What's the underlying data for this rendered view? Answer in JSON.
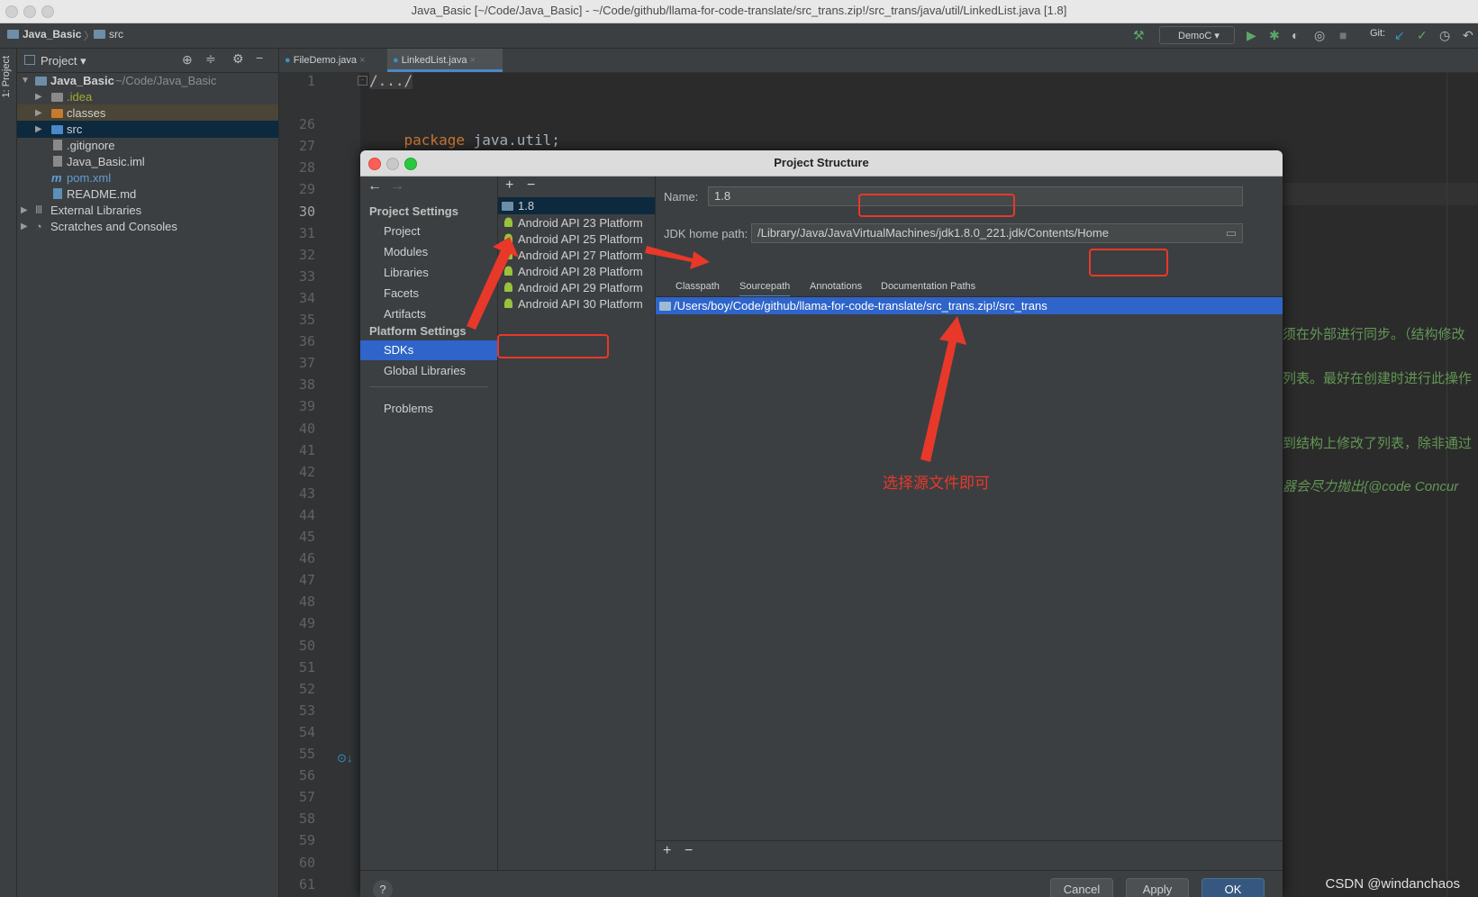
{
  "window": {
    "title": "Java_Basic [~/Code/Java_Basic] - ~/Code/github/llama-for-code-translate/src_trans.zip!/src_trans/java/util/LinkedList.java [1.8]"
  },
  "navbar": {
    "breadcrumb": [
      "Java_Basic",
      "src"
    ],
    "run_config": "DemoC",
    "git_label": "Git:"
  },
  "sidebar_strip": {
    "project_label": "1: Project"
  },
  "project_panel": {
    "header": "Project",
    "tree": [
      {
        "label": "Java_Basic",
        "suffix": "~/Code/Java_Basic"
      },
      {
        "label": ".idea"
      },
      {
        "label": "classes"
      },
      {
        "label": "src"
      },
      {
        "label": ".gitignore"
      },
      {
        "label": "Java_Basic.iml"
      },
      {
        "label": "pom.xml"
      },
      {
        "label": "README.md"
      },
      {
        "label": "External Libraries"
      },
      {
        "label": "Scratches and Consoles"
      }
    ]
  },
  "editor": {
    "tabs": [
      {
        "label": "FileDemo.java"
      },
      {
        "label": "LinkedList.java"
      }
    ],
    "line_numbers": [
      "1",
      "26",
      "27",
      "28",
      "29",
      "30",
      "31",
      "32",
      "33",
      "34",
      "35",
      "36",
      "37",
      "38",
      "39",
      "40",
      "41",
      "42",
      "43",
      "44",
      "45",
      "46",
      "47",
      "48",
      "49",
      "50",
      "51",
      "52",
      "53",
      "54",
      "55",
      "56",
      "57",
      "58",
      "59",
      "60",
      "61"
    ],
    "code": {
      "fold": "/.../",
      "package_kw": "package",
      "package_name": "java.util;"
    },
    "comment_fragments": [
      "须在外部进行同步。（结构修改",
      "列表。最好在创建时进行此操作",
      "到结构上修改了列表，除非通过",
      "器会尽力抛出{@code Concur"
    ]
  },
  "dialog": {
    "title": "Project Structure",
    "nav": {
      "project_settings_header": "Project Settings",
      "project_settings": [
        "Project",
        "Modules",
        "Libraries",
        "Facets",
        "Artifacts"
      ],
      "platform_settings_header": "Platform Settings",
      "platform_settings": [
        "SDKs",
        "Global Libraries"
      ],
      "problems": "Problems"
    },
    "sdk_list": {
      "add": "+",
      "remove": "−",
      "items": [
        "1.8",
        "Android API 23 Platform",
        "Android API 25 Platform",
        "Android API 27 Platform",
        "Android API 28 Platform",
        "Android API 29 Platform",
        "Android API 30 Platform"
      ]
    },
    "detail": {
      "name_label": "Name:",
      "name_value": "1.8",
      "jdk_home_label": "JDK home path:",
      "jdk_home_value": "/Library/Java/JavaVirtualMachines/jdk1.8.0_221.jdk/Contents/Home",
      "tabs": [
        "Classpath",
        "Sourcepath",
        "Annotations",
        "Documentation Paths"
      ],
      "selected_tab": "Sourcepath",
      "paths": [
        "/Users/boy/Code/github/llama-for-code-translate/src_trans.zip!/src_trans"
      ],
      "add": "+",
      "remove": "−"
    },
    "buttons": {
      "help": "?",
      "cancel": "Cancel",
      "apply": "Apply",
      "ok": "OK"
    }
  },
  "annotation": {
    "text": "选择源文件即可"
  },
  "watermark": "CSDN @windanchaos",
  "colors": {
    "selection": "#2f65ca",
    "annotation_red": "#e8382a",
    "keyword": "#cc7832",
    "comment": "#629755"
  }
}
